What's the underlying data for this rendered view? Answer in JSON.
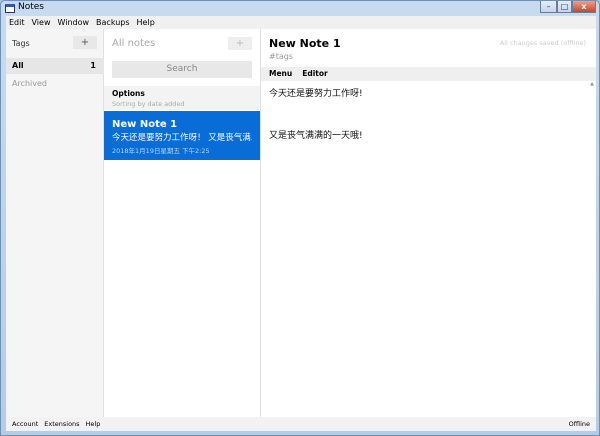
{
  "window": {
    "title": "Notes"
  },
  "menu": [
    "Edit",
    "View",
    "Window",
    "Backups",
    "Help"
  ],
  "tags": {
    "header": "Tags",
    "add": "+",
    "items": [
      {
        "label": "All",
        "count": "1"
      },
      {
        "label": "Archived"
      }
    ]
  },
  "list": {
    "title": "All notes",
    "add": "+",
    "search_placeholder": "Search",
    "options_label": "Options",
    "sort_label": "Sorting by date added",
    "notes": [
      {
        "title": "New Note 1",
        "preview": "今天还是要努力工作呀！ 又是丧气满...",
        "date": "2018年1月19日星期五 下午2:25"
      }
    ]
  },
  "editor": {
    "title": "New Note 1",
    "status": "All changes saved (offline)",
    "tags_placeholder": "#tags",
    "tabs": [
      "Menu",
      "Editor"
    ],
    "lines": [
      "今天还是要努力工作呀!",
      "",
      "又是丧气满满的一天哦!"
    ]
  },
  "footer": {
    "links": [
      "Account",
      "Extensions",
      "Help"
    ],
    "status": "Offline"
  }
}
